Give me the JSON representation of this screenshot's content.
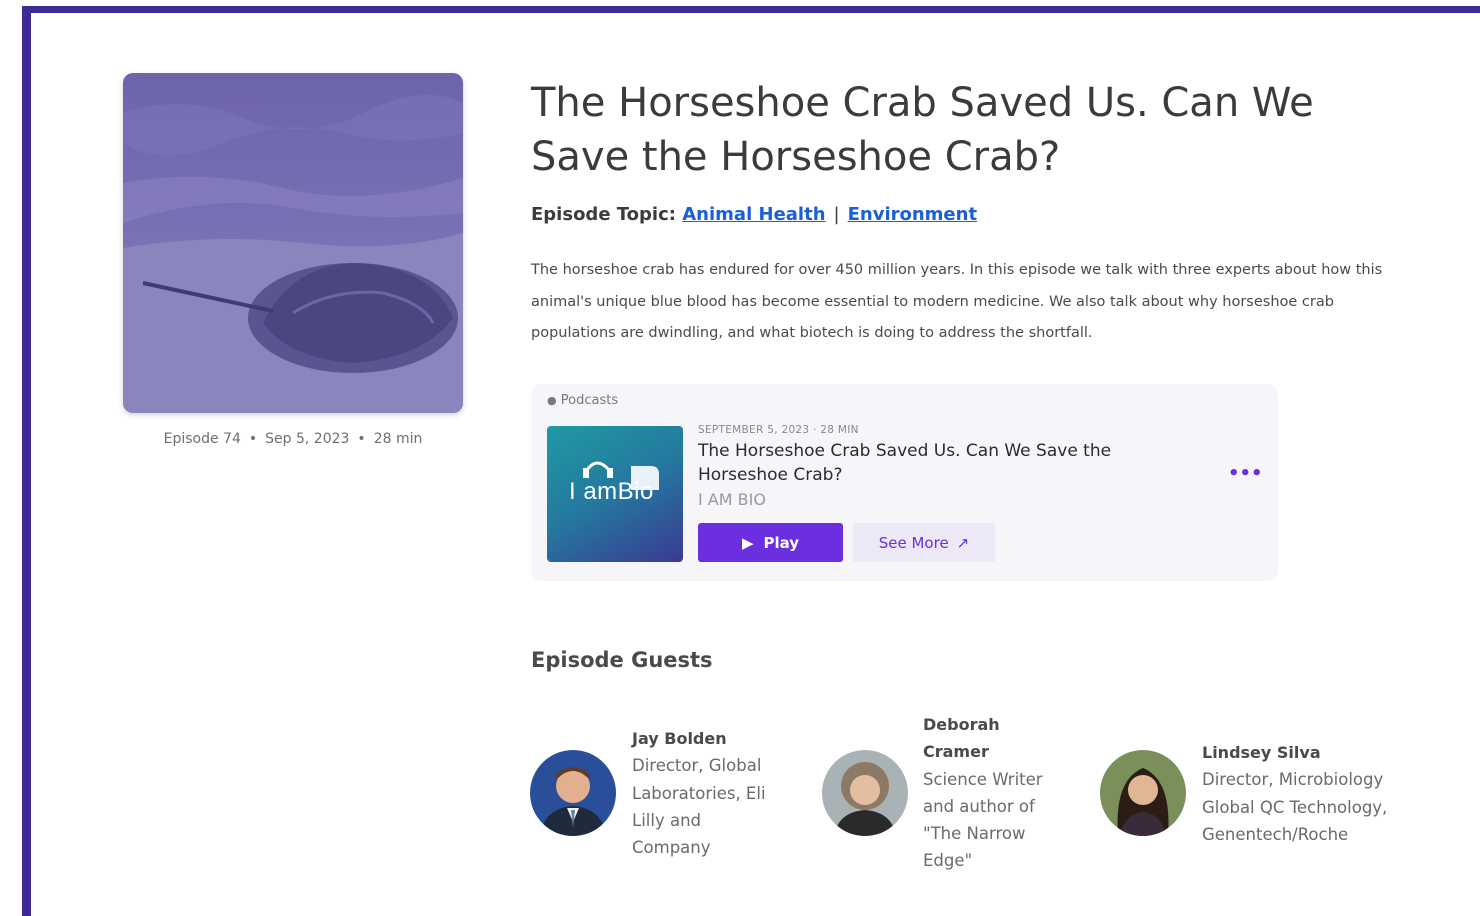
{
  "episode": {
    "number_label": "Episode 74",
    "date_label": "Sep 5, 2023",
    "duration_label": "28 min",
    "separator": "•",
    "title": "The Horseshoe Crab Saved Us. Can We Save the Horseshoe Crab?",
    "topic_label": "Episode Topic:",
    "topics": [
      "Animal Health",
      "Environment"
    ],
    "topic_separator": "|",
    "description": "The horseshoe crab has endured for over 450 million years. In this episode we talk with three experts about how this animal's unique blue blood has become essential to modern medicine. We also talk about why horseshoe crab populations are dwindling, and what biotech is doing to address the shortfall."
  },
  "player": {
    "brand": "Podcasts",
    "art_text": "I amBio",
    "date_line": "SEPTEMBER 5, 2023 · 28 MIN",
    "title": "The Horseshoe Crab Saved Us. Can We Save the Horseshoe Crab?",
    "show_name": "I AM BIO",
    "play_label": "Play",
    "see_more_label": "See More",
    "more_icon": "ellipsis-icon",
    "accent_color": "#6b2fe0"
  },
  "guests_heading": "Episode Guests",
  "guests": [
    {
      "name": "Jay Bolden",
      "role_lines": [
        "Director, Global",
        "Laboratories, Eli",
        "Lilly and",
        "Company"
      ]
    },
    {
      "name_lines": [
        "Deborah",
        "Cramer"
      ],
      "role_lines": [
        "Science Writer",
        "and author of",
        "\"The Narrow",
        "Edge\""
      ]
    },
    {
      "name": "Lindsey Silva",
      "role_lines": [
        "Director, Microbiology",
        "Global QC Technology,",
        "Genentech/Roche"
      ]
    }
  ],
  "colors": {
    "frame": "#3f2a95",
    "link": "#1a5fd6",
    "cover_tint": "#6f66ad"
  }
}
